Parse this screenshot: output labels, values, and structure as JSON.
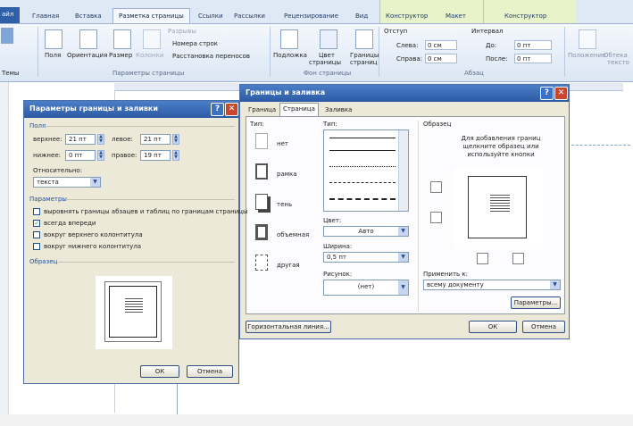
{
  "ribbon": {
    "file_tab": "айл",
    "tabs": [
      "Главная",
      "Вставка",
      "Разметка страницы",
      "Ссылки",
      "Рассылки",
      "Рецензирование",
      "Вид",
      "Конструктор",
      "Макет",
      "Конструктор"
    ],
    "buttons": {
      "margins": "Поля",
      "orientation": "Ориентация",
      "size": "Размер",
      "columns": "Колонки",
      "breaks": "Разрывы",
      "line_numbers": "Номера строк",
      "hyphenation": "Расстановка переносов",
      "themes": "Темы",
      "watermark": "Подложка",
      "page_color_1": "Цвет",
      "page_color_2": "страницы",
      "page_borders_1": "Границы",
      "page_borders_2": "страниц",
      "position": "Положение",
      "wrap": "Обтека",
      "wrap_2": "тексто"
    },
    "indent": {
      "title": "Отступ",
      "left_label": "Слева:",
      "left_value": "0 см",
      "right_label": "Справа:",
      "right_value": "0 см"
    },
    "spacing": {
      "title": "Интервал",
      "before_label": "До:",
      "before_value": "0 пт",
      "after_label": "После:",
      "after_value": "0 пт"
    },
    "groups": {
      "page_setup": "Параметры страницы",
      "page_background": "Фон страницы",
      "paragraph": "Абзац"
    }
  },
  "options_dialog": {
    "title": "Параметры границы и заливки",
    "help": "?",
    "close": "✕",
    "margins_section": "Поля",
    "top_label": "верхнее:",
    "top_value": "21 пт",
    "bottom_label": "нижнее:",
    "bottom_value": "0 пт",
    "left_label": "левое:",
    "left_value": "21 пт",
    "right_label": "правое:",
    "right_value": "19 пт",
    "relative_label": "Относительно:",
    "relative_value": "текста",
    "params_section": "Параметры",
    "checkboxes": [
      {
        "label": "выровнять границы абзацев и таблиц по границам страницы",
        "checked": false
      },
      {
        "label": "всегда впереди",
        "checked": true
      },
      {
        "label": "вокруг верхнего колонтитула",
        "checked": false
      },
      {
        "label": "вокруг нижнего колонтитула",
        "checked": false
      }
    ],
    "preview_section": "Образец",
    "ok": "ОК",
    "cancel": "Отмена"
  },
  "borders_dialog": {
    "title": "Границы и заливка",
    "help": "?",
    "close": "✕",
    "tabs": [
      "Граница",
      "Страница",
      "Заливка"
    ],
    "active_tab": "Страница",
    "type_label": "Тип:",
    "settings": [
      "нет",
      "рамка",
      "тень",
      "объемная",
      "другая"
    ],
    "style_label": "Тип:",
    "color_label": "Цвет:",
    "color_value": "Авто",
    "width_label": "Ширина:",
    "width_value": "0,5 пт",
    "art_label": "Рисунок:",
    "art_value": "(нет)",
    "preview_label": "Образец",
    "preview_hint": "Для добавления границ щелкните образец или используйте кнопки",
    "apply_label": "Применить к:",
    "apply_value": "всему документу",
    "options_button": "Параметры...",
    "hline_button": "Горизонтальная линия...",
    "ok": "ОК",
    "cancel": "Отмена"
  },
  "colors": {
    "title_bar": "#2b5aa3",
    "close_button": "#c9472c",
    "dialog_bg": "#ece9d8",
    "ribbon_bg": "#dfe9f5",
    "context_tab": "#e8f3c9"
  }
}
